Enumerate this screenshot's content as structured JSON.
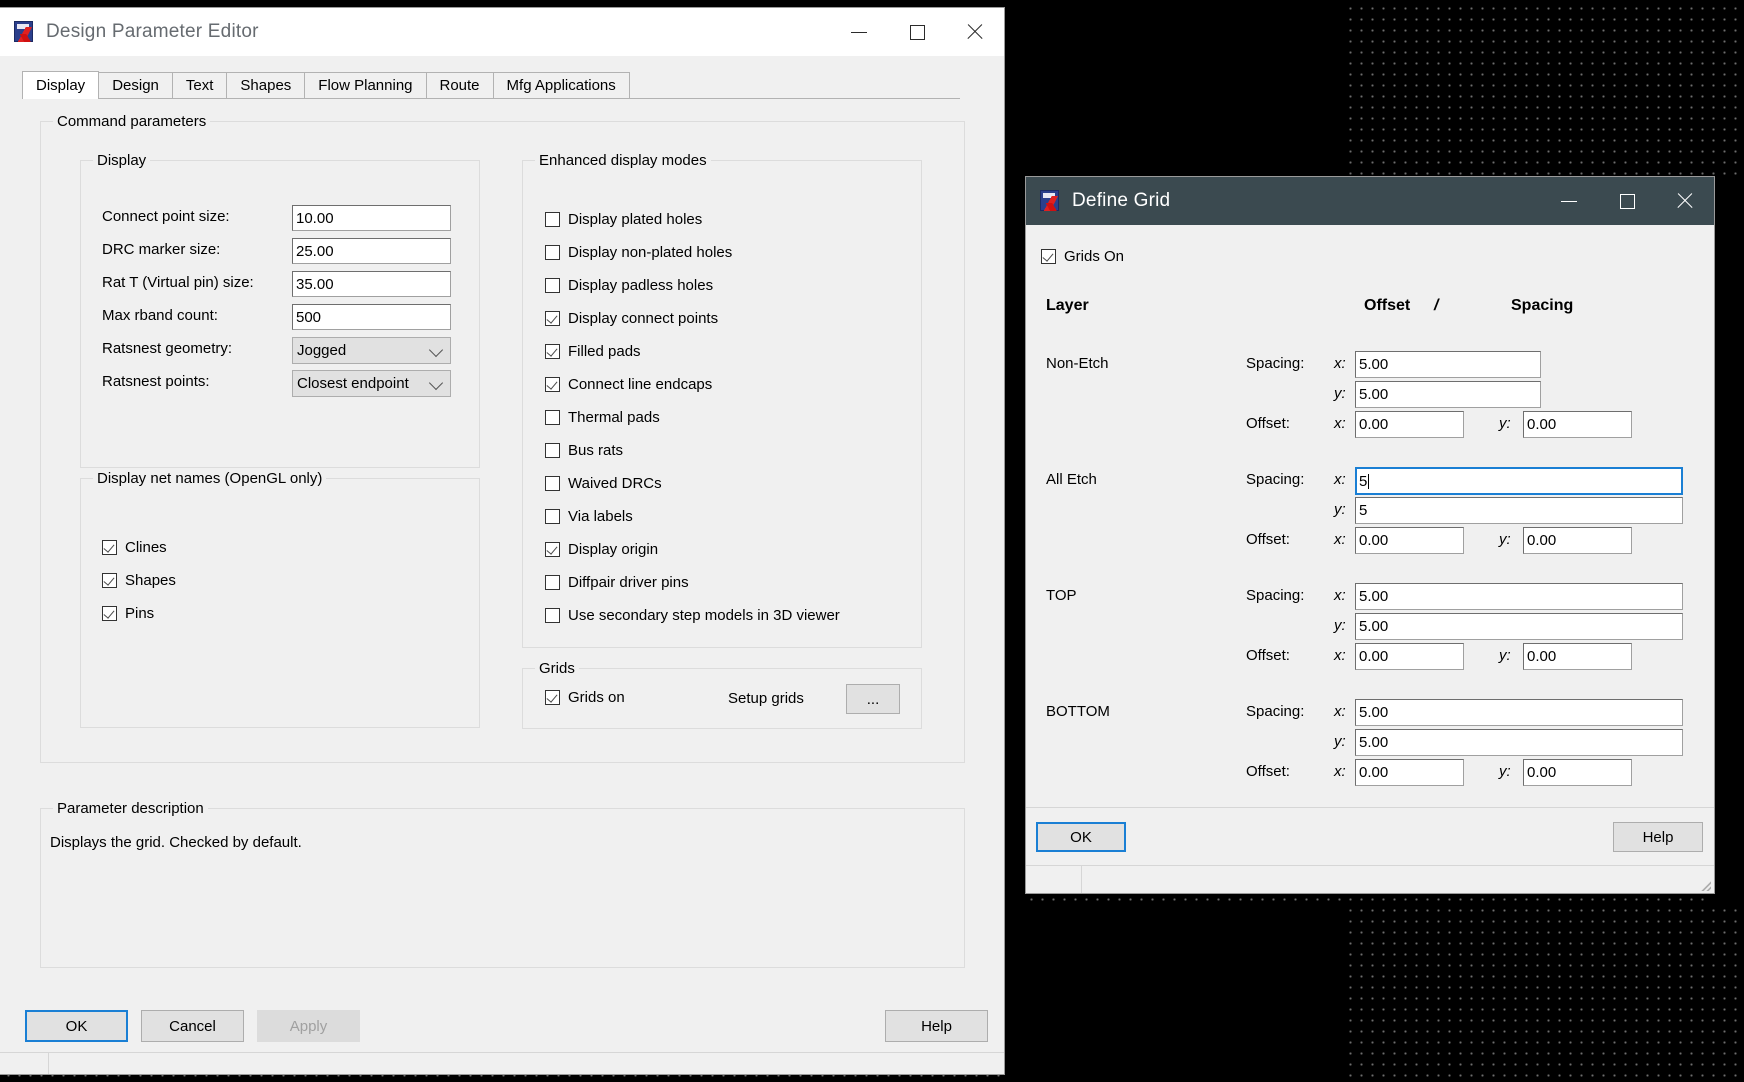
{
  "canvas": {
    "name": "pcb-design-canvas"
  },
  "design_parameter_editor": {
    "title": "Design Parameter Editor",
    "icon": "allegro-app-icon",
    "window_controls": {
      "minimize": "minimize-icon",
      "maximize": "maximize-icon",
      "close": "close-icon"
    },
    "tabs": [
      {
        "label": "Display",
        "active": true
      },
      {
        "label": "Design",
        "active": false
      },
      {
        "label": "Text",
        "active": false
      },
      {
        "label": "Shapes",
        "active": false
      },
      {
        "label": "Flow Planning",
        "active": false
      },
      {
        "label": "Route",
        "active": false
      },
      {
        "label": "Mfg Applications",
        "active": false
      }
    ],
    "command_parameters": {
      "title": "Command parameters",
      "display_group": {
        "title": "Display",
        "fields": [
          {
            "label": "Connect point size:",
            "value": "10.00",
            "type": "text"
          },
          {
            "label": "DRC marker size:",
            "value": "25.00",
            "type": "text"
          },
          {
            "label": "Rat T (Virtual pin) size:",
            "value": "35.00",
            "type": "text"
          },
          {
            "label": "Max rband count:",
            "value": "500",
            "type": "text"
          },
          {
            "label": "Ratsnest geometry:",
            "value": "Jogged",
            "type": "combo"
          },
          {
            "label": "Ratsnest points:",
            "value": "Closest endpoint",
            "type": "combo"
          }
        ]
      },
      "net_names_group": {
        "title": "Display net names (OpenGL only)",
        "items": [
          {
            "label": "Clines",
            "checked": true
          },
          {
            "label": "Shapes",
            "checked": true
          },
          {
            "label": "Pins",
            "checked": true
          }
        ]
      },
      "enhanced_group": {
        "title": "Enhanced display modes",
        "items": [
          {
            "label": "Display plated holes",
            "checked": false
          },
          {
            "label": "Display non-plated holes",
            "checked": false
          },
          {
            "label": "Display padless holes",
            "checked": false
          },
          {
            "label": "Display connect points",
            "checked": true
          },
          {
            "label": "Filled pads",
            "checked": true
          },
          {
            "label": "Connect line endcaps",
            "checked": true
          },
          {
            "label": "Thermal pads",
            "checked": false
          },
          {
            "label": "Bus rats",
            "checked": false
          },
          {
            "label": "Waived DRCs",
            "checked": false
          },
          {
            "label": "Via labels",
            "checked": false
          },
          {
            "label": "Display origin",
            "checked": true
          },
          {
            "label": "Diffpair driver pins",
            "checked": false
          },
          {
            "label": "Use secondary step models in 3D viewer",
            "checked": false
          }
        ]
      },
      "grids_group": {
        "title": "Grids",
        "grids_on": {
          "label": "Grids on",
          "checked": true
        },
        "setup_grids_label": "Setup grids",
        "setup_grids_button": "..."
      }
    },
    "parameter_description": {
      "title": "Parameter description",
      "text": "Displays the grid. Checked by default."
    },
    "footer_buttons": [
      {
        "label": "OK",
        "state": "default"
      },
      {
        "label": "Cancel",
        "state": "normal"
      },
      {
        "label": "Apply",
        "state": "disabled"
      },
      {
        "label": "Help",
        "state": "normal"
      }
    ]
  },
  "define_grid": {
    "title": "Define Grid",
    "icon": "allegro-app-icon",
    "window_controls": {
      "minimize": "minimize-icon",
      "maximize": "maximize-icon",
      "close": "close-icon"
    },
    "grids_on": {
      "label": "Grids On",
      "checked": true
    },
    "headers": {
      "layer": "Layer",
      "offset": "Offset",
      "separator": "/",
      "spacing": "Spacing"
    },
    "labels": {
      "spacing": "Spacing:",
      "offset": "Offset:",
      "x": "x:",
      "y": "y:"
    },
    "rows": [
      {
        "layer": "Non-Etch",
        "spacing_x": "5.00",
        "spacing_y": "5.00",
        "offset_x": "0.00",
        "offset_y": "0.00",
        "focused": false,
        "wide": false
      },
      {
        "layer": "All Etch",
        "spacing_x": "5",
        "spacing_y": "5",
        "offset_x": "0.00",
        "offset_y": "0.00",
        "focused": true,
        "wide": true
      },
      {
        "layer": "TOP",
        "spacing_x": "5.00",
        "spacing_y": "5.00",
        "offset_x": "0.00",
        "offset_y": "0.00",
        "focused": false,
        "wide": true
      },
      {
        "layer": "BOTTOM",
        "spacing_x": "5.00",
        "spacing_y": "5.00",
        "offset_x": "0.00",
        "offset_y": "0.00",
        "focused": false,
        "wide": true
      }
    ],
    "footer_buttons": [
      {
        "label": "OK",
        "state": "default"
      },
      {
        "label": "Help",
        "state": "normal"
      }
    ]
  },
  "colors": {
    "accent_focus": "#1a7fd4",
    "dialog_face": "#f0f0f0",
    "titlebar_dark": "#3b4a50",
    "titlebar_light": "#ffffff",
    "canvas_dot": "#6d6d6d"
  }
}
